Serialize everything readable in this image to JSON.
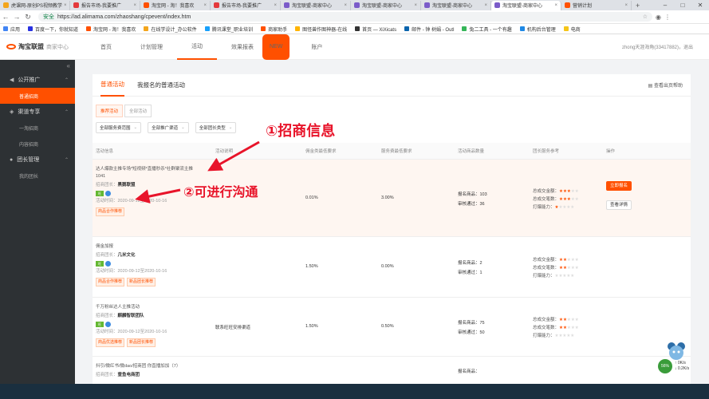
{
  "browser": {
    "tabs": [
      {
        "label": "虎课网-原创PS视频教学",
        "color": "#f3a51c",
        "active": false
      },
      {
        "label": "报告市场-我要推广",
        "color": "#e4393c",
        "active": false
      },
      {
        "label": "淘宝网 - 淘！我喜欢",
        "color": "#ff5000",
        "active": false
      },
      {
        "label": "报告市场-我要推广",
        "color": "#e4393c",
        "active": false
      },
      {
        "label": "淘宝联盟-商家中心",
        "color": "#7b5cc9",
        "active": false
      },
      {
        "label": "淘宝联盟-商家中心",
        "color": "#7b5cc9",
        "active": false
      },
      {
        "label": "淘宝联盟-商家中心",
        "color": "#7b5cc9",
        "active": false
      },
      {
        "label": "淘宝联盟-商家中心",
        "color": "#7b5cc9",
        "active": true
      },
      {
        "label": "营销计划",
        "color": "#ff5000",
        "active": false
      }
    ],
    "secure_label": "安全",
    "url": "https://ad.alimama.com/zhaoshang/cpevent/index.htm",
    "bookmarks": [
      {
        "label": "应用",
        "color": "#4285f4"
      },
      {
        "label": "百度一下，你就知道",
        "color": "#2932e1"
      },
      {
        "label": "淘宝网 - 淘！我喜欢",
        "color": "#ff5000"
      },
      {
        "label": "在线学设计_办公软件",
        "color": "#f3a51c"
      },
      {
        "label": "腾讯课堂_职业培训",
        "color": "#18a0fb"
      },
      {
        "label": "商家助手",
        "color": "#ff5000"
      },
      {
        "label": "图怪兽作图神器-在线",
        "color": "#ffb400"
      },
      {
        "label": "首页 — XiXicats",
        "color": "#333333"
      },
      {
        "label": "邮件 - 钟 树娟 - Outl",
        "color": "#0a64ad"
      },
      {
        "label": "兔二工具 - 一个有趣",
        "color": "#35b558"
      },
      {
        "label": "机构后台管理",
        "color": "#1e88e5"
      },
      {
        "label": "电商",
        "color": "#f5c518"
      }
    ]
  },
  "site": {
    "logo_text": "淘宝联盟",
    "logo_sub": "商家中心",
    "nav": [
      {
        "label": "首页",
        "current": false,
        "new": false
      },
      {
        "label": "计划管理",
        "current": false,
        "new": false
      },
      {
        "label": "活动",
        "current": true,
        "new": false
      },
      {
        "label": "效果报表",
        "current": false,
        "new": true
      },
      {
        "label": "账户",
        "current": false,
        "new": false
      }
    ],
    "new_badge": "NEW",
    "user": "zhong天涯海角(33417882)，退出"
  },
  "sidebar": {
    "collapse": "«",
    "groups": [
      {
        "label": "公开推广",
        "icon": "megaphone-icon",
        "items": [
          {
            "label": "普通招商",
            "current": true
          }
        ]
      },
      {
        "label": "渠道专享",
        "icon": "tag-icon",
        "items": [
          {
            "label": "一淘招商",
            "current": false
          },
          {
            "label": "内容招商",
            "current": false
          }
        ]
      },
      {
        "label": "团长管理",
        "icon": "user-icon",
        "items": [
          {
            "label": "我的团长",
            "current": false
          }
        ]
      }
    ]
  },
  "content": {
    "tabs": [
      "普通活动",
      "我报名的普通活动"
    ],
    "help_link": "查看出页帮助",
    "subtabs": [
      "推荐活动",
      "全部活动"
    ],
    "filters": [
      "全部服务费范围",
      "全部推广渠道",
      "全部团长类型"
    ],
    "headers": [
      "活动信息",
      "活动说明",
      "佣金类最低要求",
      "服务费最低要求",
      "活动商品数量",
      "团长服务参考",
      "操作"
    ],
    "rows": [
      {
        "name": "达人爆款主推专场*短视频*直播秒杀*社群聚流主推",
        "name2": "1041",
        "leader_label": "招商团长：",
        "leader": "黑鹅联盟",
        "date": "活动时间：2020-09-12至2020-10-16",
        "tags": [
          "商品合作推荐"
        ],
        "desc": "",
        "commission": "0.01%",
        "fee": "3.00%",
        "stat1": "报名商品：103",
        "stat2": "审核通过：36",
        "s1": "总成交金额：",
        "s2": "总成交笔数：",
        "s3": "打爆能力：",
        "stars": [
          3,
          3,
          1
        ],
        "actions": [
          "立即报名",
          "查看详情"
        ]
      },
      {
        "name": "佣金加报",
        "name2": "",
        "leader_label": "招商团长：",
        "leader": "几米文化",
        "date": "活动时间：2020-09-12至2020-10-16",
        "tags": [
          "商品合作推荐",
          "新品团长推荐"
        ],
        "desc": "",
        "commission": "1.50%",
        "fee": "0.00%",
        "stat1": "报名商品：2",
        "stat2": "审核通过：1",
        "s1": "总成交金额：",
        "s2": "总成交笔数：",
        "s3": "打爆能力：",
        "stars": [
          2,
          2,
          0
        ],
        "actions": []
      },
      {
        "name": "千万粉丝达人主推活动",
        "name2": "",
        "leader_label": "招商团长：",
        "leader": "麒麟智联团队",
        "date": "活动时间：2020-09-12至2020-10-16",
        "tags": [
          "商品优选推荐",
          "新品团长推荐"
        ],
        "desc": "联系旺旺安排渠道",
        "commission": "1.50%",
        "fee": "0.50%",
        "stat1": "报名商品：75",
        "stat2": "审核通过：50",
        "s1": "总成交金额：",
        "s2": "总成交笔数：",
        "s3": "打爆能力：",
        "stars": [
          2,
          2,
          0
        ],
        "actions": []
      },
      {
        "name": "抖引/微红书/微dao/招商团 你直播加加（7）",
        "name2": "",
        "leader_label": "招商团长：",
        "leader": "壹鱼电商团",
        "date": "",
        "tags": [],
        "desc": "",
        "commission": "",
        "fee": "",
        "stat1": "报名商品：",
        "stat2": "",
        "s1": "",
        "s2": "",
        "s3": "",
        "stars": [],
        "actions": []
      }
    ]
  },
  "annotations": {
    "a1": "①招商信息",
    "a2": "②可进行沟通"
  },
  "tray": {
    "percent": "56%",
    "up": "0K/s",
    "down": "0.2K/s"
  }
}
